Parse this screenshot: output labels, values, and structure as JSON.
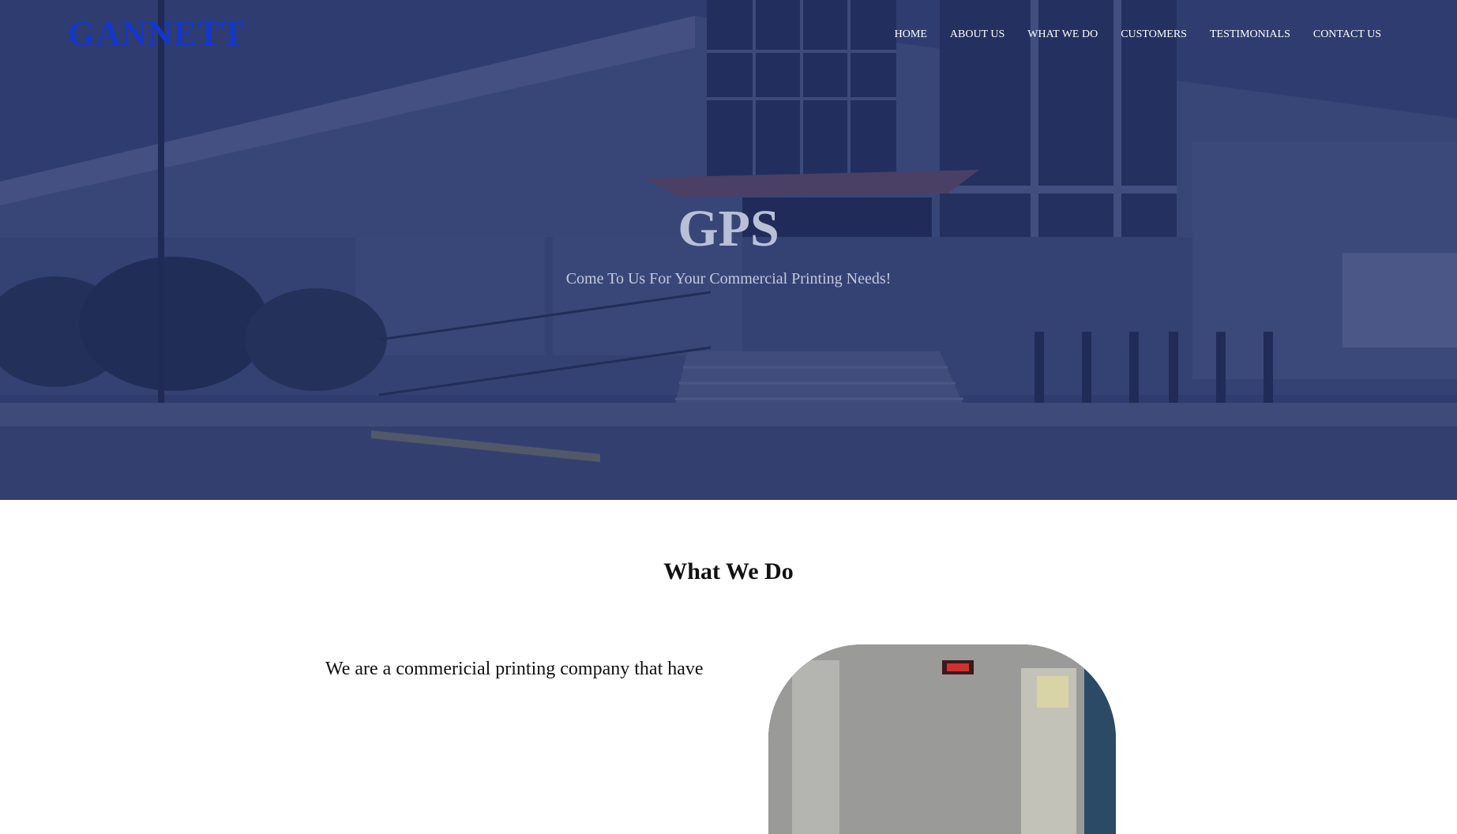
{
  "header": {
    "logo": "GANNETT",
    "nav": [
      {
        "label": "HOME"
      },
      {
        "label": "ABOUT US"
      },
      {
        "label": "WHAT WE DO"
      },
      {
        "label": "CUSTOMERS"
      },
      {
        "label": "TESTIMONIALS"
      },
      {
        "label": "CONTACT US"
      }
    ]
  },
  "hero": {
    "title": "GPS",
    "subtitle": "Come To Us For Your Commercial Printing Needs!",
    "overlay_color": "#223268"
  },
  "what_we_do": {
    "heading": "What We Do",
    "text": "We are a commericial printing company that have"
  },
  "colors": {
    "logo": "#1537c7",
    "nav_text": "#ffffff",
    "heading_text": "#111111"
  }
}
